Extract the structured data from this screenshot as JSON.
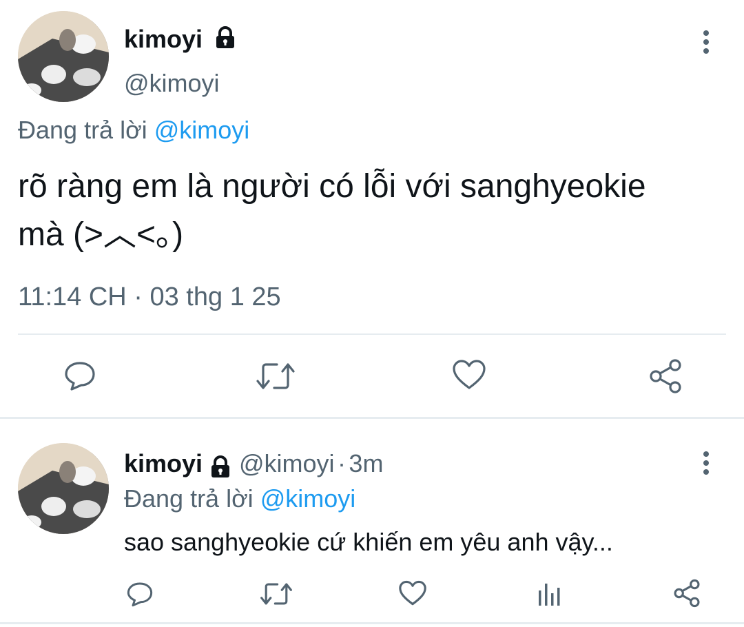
{
  "main_tweet": {
    "display_name": "kimoyi",
    "handle": "@kimoyi",
    "reply_prefix": "Đang trả lời",
    "reply_to": "@kimoyi",
    "text_line1": "rõ ràng em là người có lỗi với sanghyeokie",
    "text_line2": "mà (>︿<｡)",
    "timestamp": "11:14 CH · 03 thg 1 25",
    "actions": [
      "reply-icon",
      "retweet-icon",
      "like-icon",
      "share-icon"
    ]
  },
  "reply_tweet": {
    "display_name": "kimoyi",
    "handle": "@kimoyi",
    "separator": "·",
    "age": "3m",
    "reply_prefix": "Đang trả lời",
    "reply_to": "@kimoyi",
    "text": "sao sanghyeokie cứ khiến em yêu anh vậy...",
    "actions": [
      "reply-icon",
      "retweet-icon",
      "like-icon",
      "analytics-icon",
      "share-icon"
    ]
  },
  "colors": {
    "accent": "#1d9bf0",
    "muted": "#536471",
    "text": "#0f1419",
    "divider": "#e6ecf0"
  }
}
